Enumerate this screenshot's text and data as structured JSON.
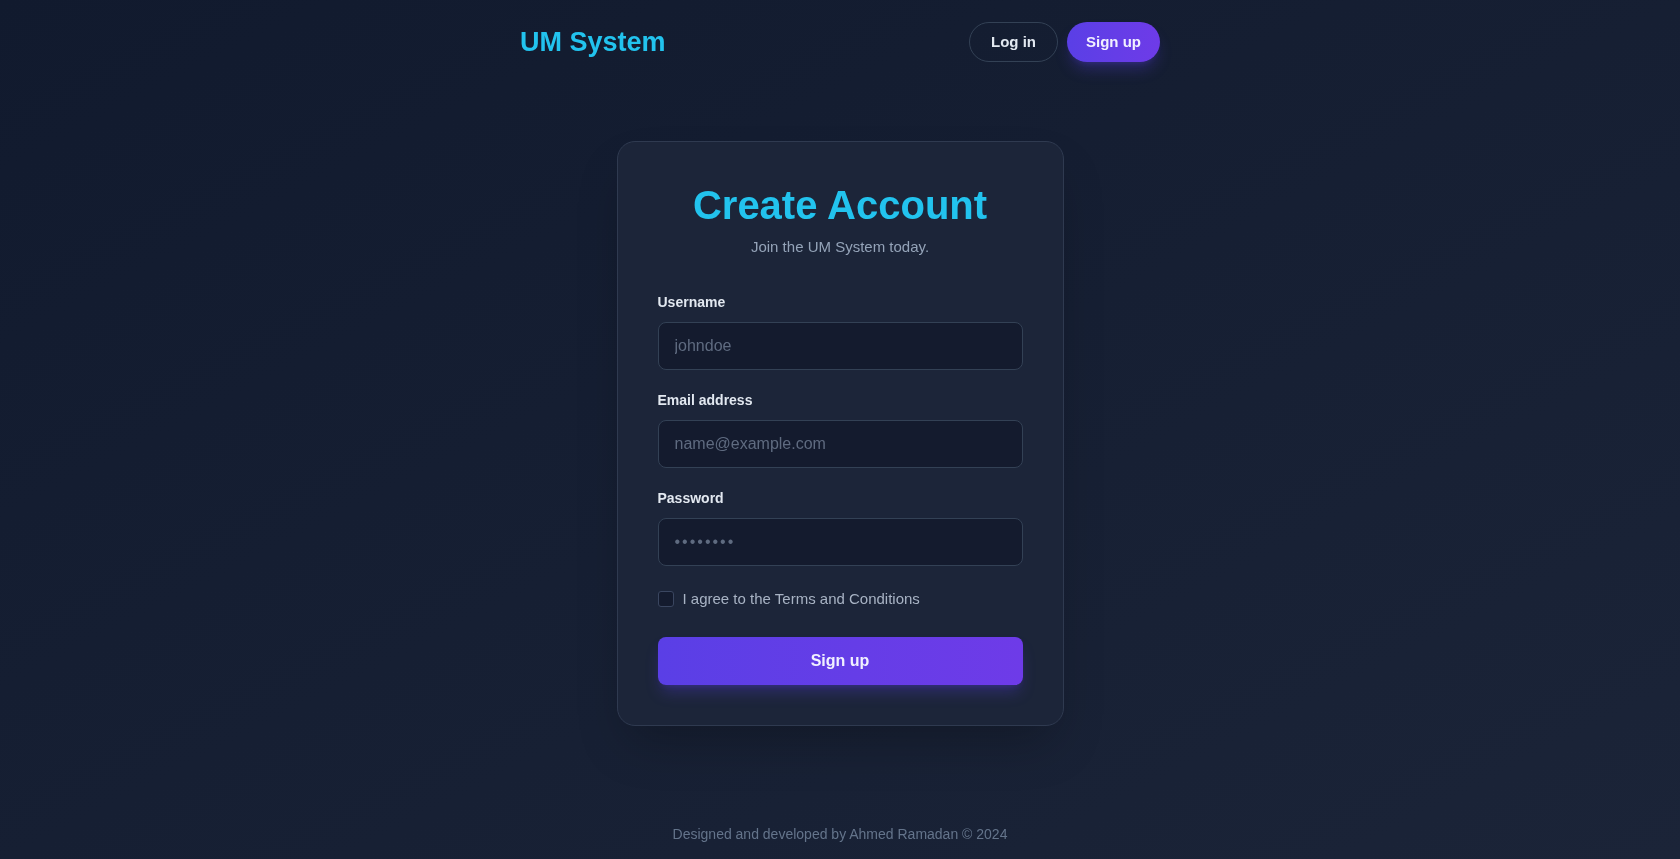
{
  "header": {
    "logo": "UM System",
    "buttons": [
      {
        "label": "Log in",
        "kind": "outline"
      },
      {
        "label": "Sign up",
        "kind": "primary"
      }
    ]
  },
  "card": {
    "title": "Create Account",
    "subtitle": "Join the UM System today.",
    "fields": [
      {
        "label": "Username",
        "placeholder": "johndoe",
        "kind": "text"
      },
      {
        "label": "Email address",
        "placeholder": "name@example.com",
        "kind": "email"
      },
      {
        "label": "Password",
        "placeholder": "••••••••",
        "kind": "password"
      }
    ],
    "agree": {
      "label": "I agree to the Terms and Conditions",
      "checked": false
    },
    "submit": "Sign up"
  },
  "footer": "Designed and developed by Ahmed Ramadan © 2024"
}
